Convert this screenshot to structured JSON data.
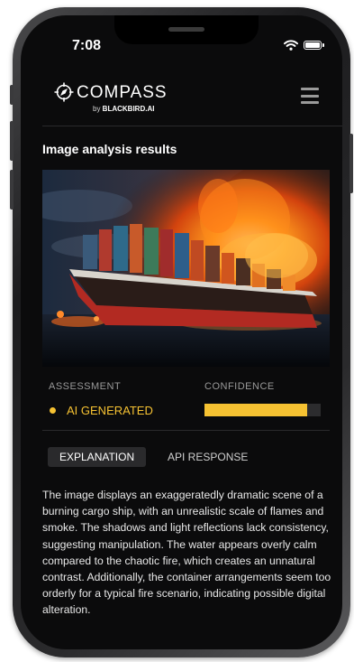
{
  "status_bar": {
    "time": "7:08",
    "icons": [
      "wifi-icon",
      "battery-icon"
    ]
  },
  "header": {
    "logo_icon": "compass-logo-icon",
    "brand": "COMPASS",
    "byline_prefix": "by ",
    "byline_brand": "BLACKBIRD",
    "byline_suffix": ".AI",
    "menu_icon": "hamburger-menu-icon"
  },
  "page": {
    "title": "Image analysis results"
  },
  "analyzed_image": {
    "subject": "burning container ship at sea"
  },
  "result": {
    "assessment_label": "ASSESSMENT",
    "confidence_label": "CONFIDENCE",
    "assessment_value": "AI GENERATED",
    "confidence_fraction": 0.88,
    "accent_color": "#f6c232"
  },
  "tabs": [
    {
      "label": "EXPLANATION",
      "active": true
    },
    {
      "label": "API RESPONSE",
      "active": false
    }
  ],
  "explanation": "The image displays an exaggeratedly dramatic scene of a burning cargo ship, with an unrealistic scale of flames and smoke. The shadows and light reflections lack consistency, suggesting manipulation. The water appears overly calm compared to the chaotic fire, which creates an unnatural contrast. Additionally, the container arrangements seem too orderly for a typical fire scenario, indicating possible digital alteration."
}
